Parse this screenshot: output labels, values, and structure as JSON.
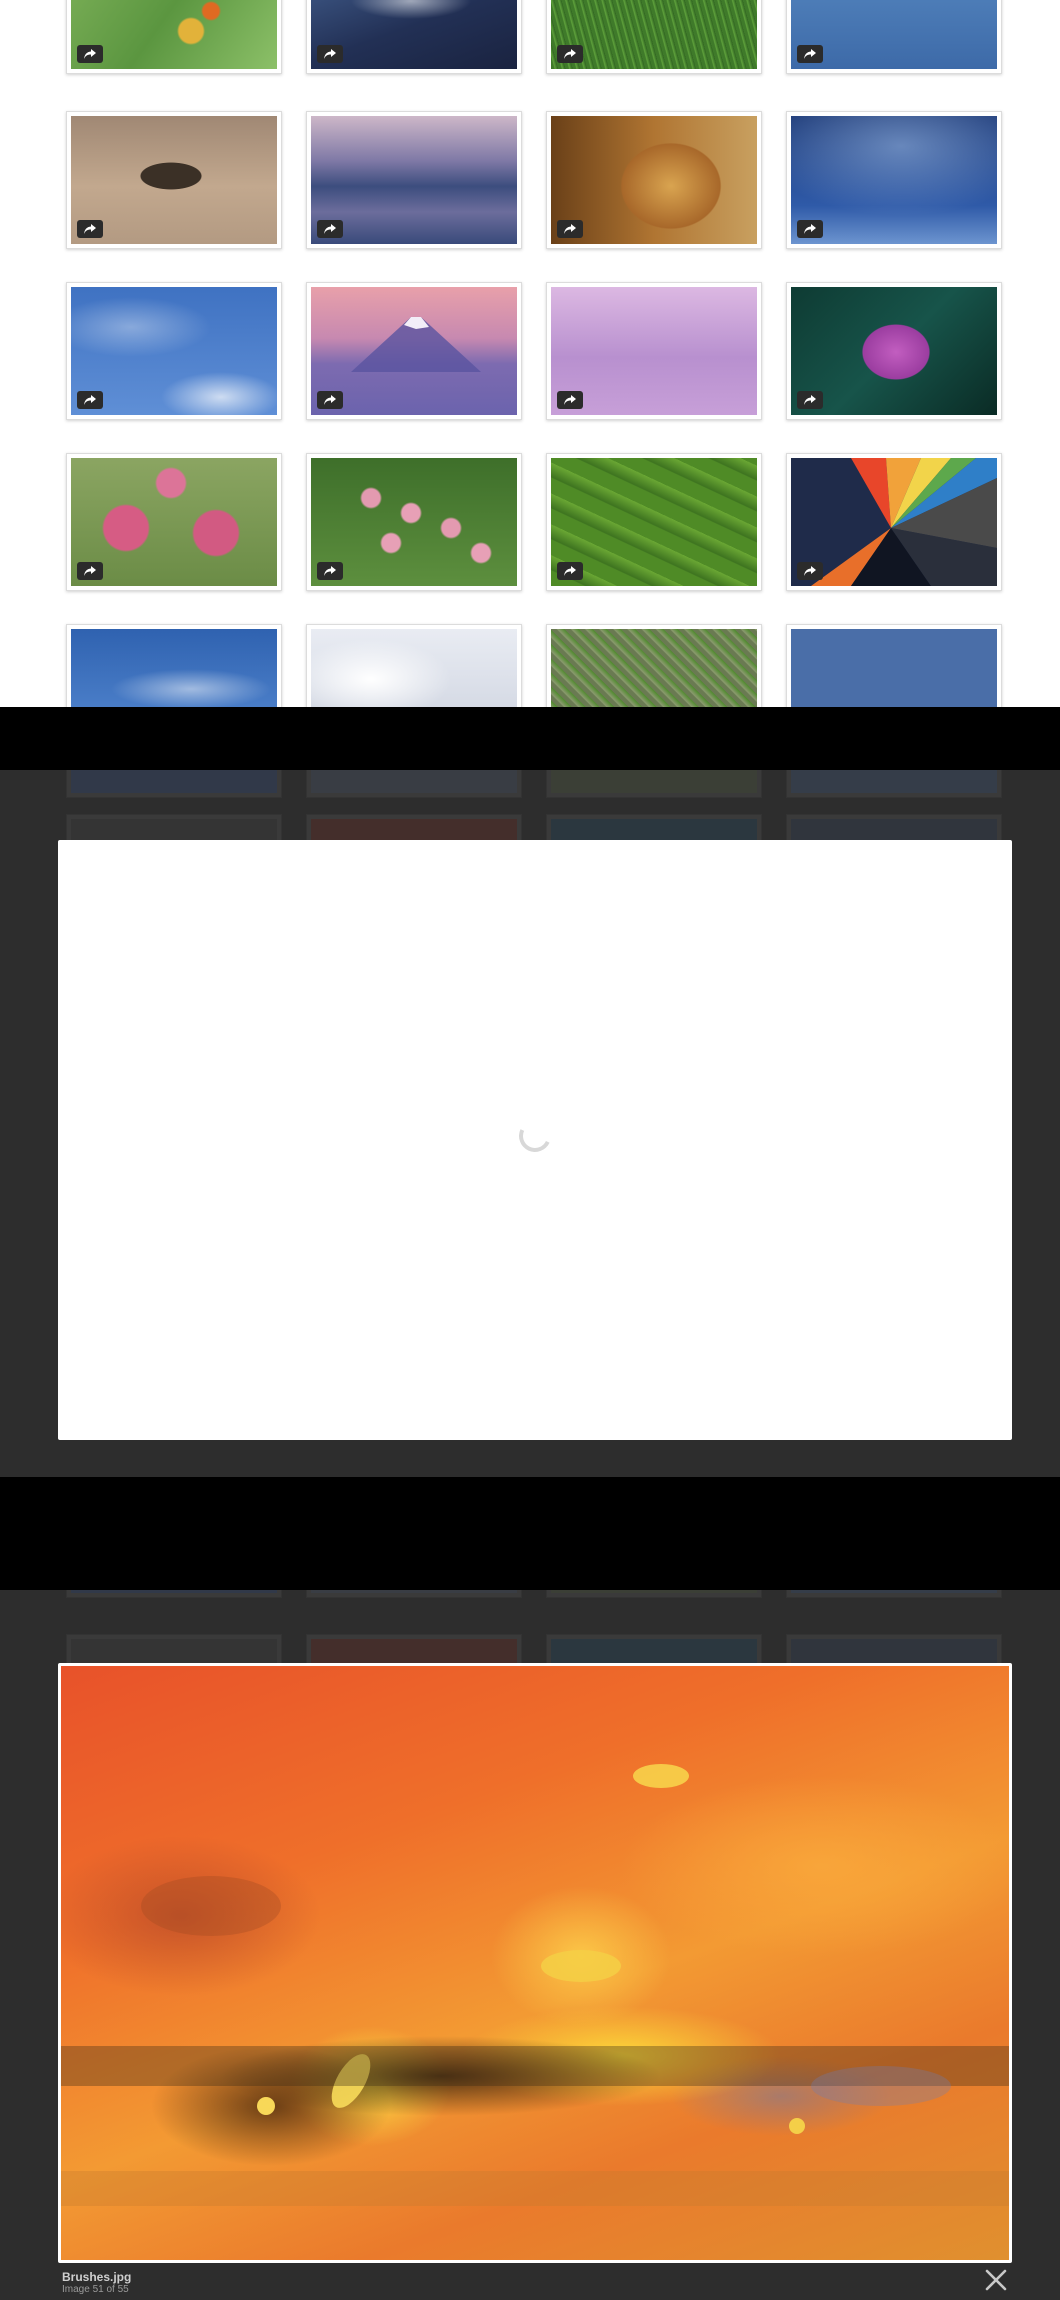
{
  "gallery": {
    "share_icon": "share-arrow-icon",
    "rows": [
      [
        "Green leaf frog",
        "Galaxy",
        "Grass",
        "Blue pattern"
      ],
      [
        "Lake island",
        "Mountain lake reflection",
        "Lion",
        "Milky way"
      ],
      [
        "Blue sky moon",
        "Mount Fuji",
        "Purple fog",
        "Lotus flower"
      ],
      [
        "Pink poppies",
        "Pink blossoms",
        "Green fields",
        "Colorful polygons"
      ],
      [
        "Blue sky",
        "White waves",
        "Zebras",
        "Blue"
      ]
    ]
  },
  "lightbox": {
    "loading_icon": "spinner-icon",
    "caption_title": "Brushes.jpg",
    "caption_count": "Image 51 of 55",
    "close_icon": "close-icon"
  }
}
